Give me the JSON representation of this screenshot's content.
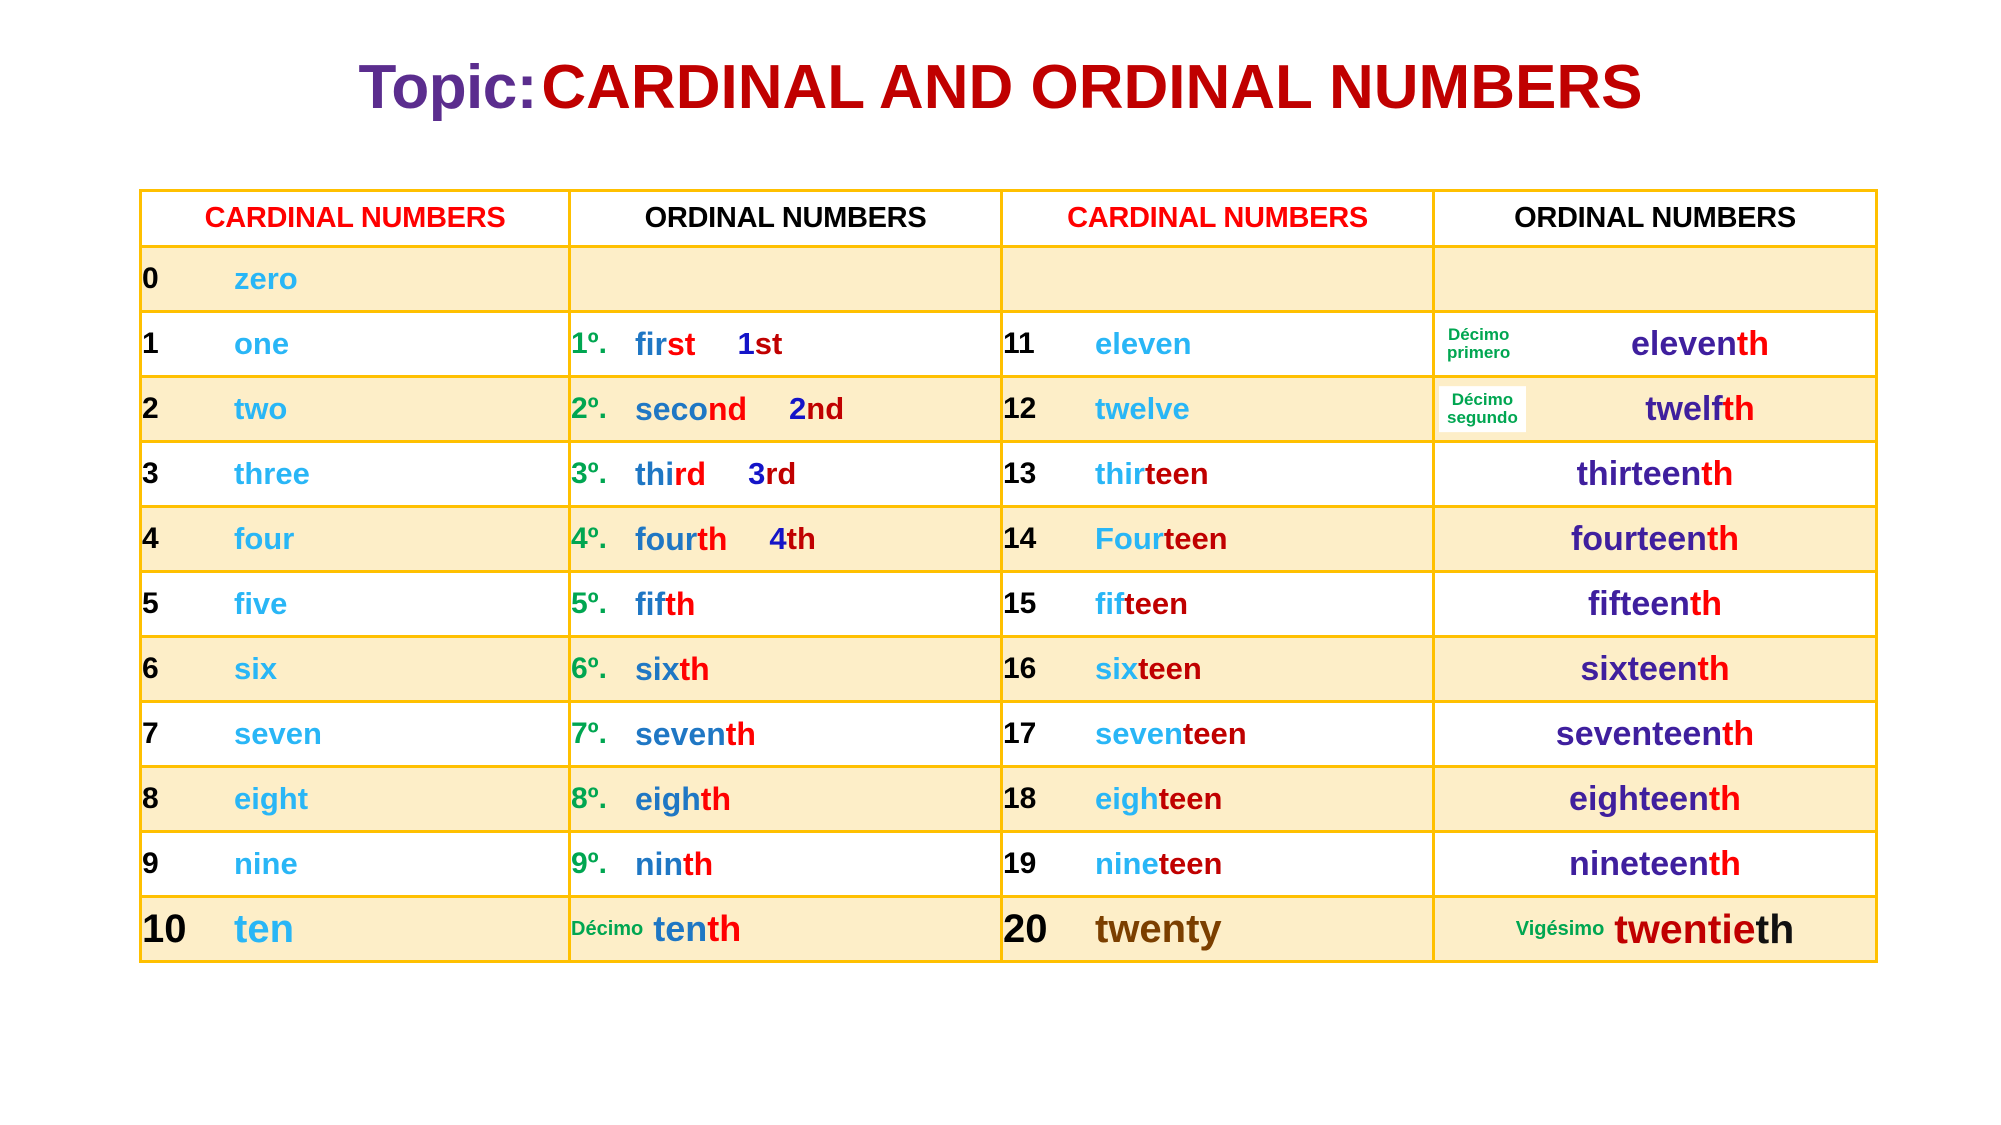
{
  "title": {
    "topic_label": "Topic:",
    "subject": "CARDINAL AND ORDINAL NUMBERS",
    "topic_color": "#5b2d8e",
    "subject_color": "#c00000"
  },
  "colors": {
    "border": "#ffc000",
    "row_shade": "#fdeec8",
    "row_plain": "#ffffff",
    "cardinal_header": "#ff0000",
    "ordinal_header": "#000000",
    "cardinal_word": "#29b6f6",
    "cardinal_suffix": "#c00000",
    "ordinal_marker_green": "#00a651",
    "ordinal_stem_blue": "#1f77c4",
    "ordinal_suffix_red": "#ff0000",
    "ordinal_stem_purple": "#3f1f9e",
    "twenty_brown": "#7b3f00"
  },
  "headers": {
    "left_cardinal": "CARDINAL NUMBERS",
    "left_ordinal": "ORDINAL NUMBERS",
    "right_cardinal": "CARDINAL NUMBERS",
    "right_ordinal": "ORDINAL NUMBERS"
  },
  "rows": [
    {
      "left": {
        "num": "0",
        "word_a": "zero",
        "word_b": ""
      },
      "left_ord": {
        "marker": "",
        "stem": "",
        "suffix": "",
        "abbr_num": "",
        "abbr_suffix": ""
      },
      "right": {
        "num": "",
        "word_a": "",
        "word_b": ""
      },
      "right_ord": {
        "hint": "",
        "stem": "",
        "suffix": ""
      }
    },
    {
      "left": {
        "num": "1",
        "word_a": "one",
        "word_b": ""
      },
      "left_ord": {
        "marker": "1º.",
        "stem": "fir",
        "suffix": "st",
        "abbr_num": "1",
        "abbr_suffix": "st"
      },
      "right": {
        "num": "11",
        "word_a": "eleven",
        "word_b": ""
      },
      "right_ord": {
        "hint": "Décimo primero",
        "stem": "eleven",
        "suffix": "th"
      }
    },
    {
      "left": {
        "num": "2",
        "word_a": "two",
        "word_b": ""
      },
      "left_ord": {
        "marker": "2º.",
        "stem": "seco",
        "suffix": "nd",
        "abbr_num": "2",
        "abbr_suffix": "nd"
      },
      "right": {
        "num": "12",
        "word_a": "twelve",
        "word_b": ""
      },
      "right_ord": {
        "hint": "Décimo segundo",
        "stem": "twelf",
        "suffix": "th"
      }
    },
    {
      "left": {
        "num": "3",
        "word_a": "three",
        "word_b": ""
      },
      "left_ord": {
        "marker": "3º.",
        "stem": "thi",
        "suffix": "rd",
        "abbr_num": "3",
        "abbr_suffix": "rd"
      },
      "right": {
        "num": "13",
        "word_a": "thir",
        "word_b": "teen"
      },
      "right_ord": {
        "hint": "",
        "stem": "thirteen",
        "suffix": "th"
      }
    },
    {
      "left": {
        "num": "4",
        "word_a": "four",
        "word_b": ""
      },
      "left_ord": {
        "marker": "4º.",
        "stem": "four",
        "suffix": "th",
        "abbr_num": "4",
        "abbr_suffix": "th"
      },
      "right": {
        "num": "14",
        "word_a": "Four",
        "word_b": "teen"
      },
      "right_ord": {
        "hint": "",
        "stem": "fourteen",
        "suffix": "th"
      }
    },
    {
      "left": {
        "num": "5",
        "word_a": "five",
        "word_b": ""
      },
      "left_ord": {
        "marker": "5º.",
        "stem": "fif",
        "suffix": "th",
        "abbr_num": "",
        "abbr_suffix": ""
      },
      "right": {
        "num": "15",
        "word_a": "fif",
        "word_b": "teen"
      },
      "right_ord": {
        "hint": "",
        "stem": "fifteen",
        "suffix": "th"
      }
    },
    {
      "left": {
        "num": "6",
        "word_a": "six",
        "word_b": ""
      },
      "left_ord": {
        "marker": "6º.",
        "stem": "six",
        "suffix": "th",
        "abbr_num": "",
        "abbr_suffix": ""
      },
      "right": {
        "num": "16",
        "word_a": "six",
        "word_b": "teen"
      },
      "right_ord": {
        "hint": "",
        "stem": "sixteen",
        "suffix": "th"
      }
    },
    {
      "left": {
        "num": "7",
        "word_a": "seven",
        "word_b": ""
      },
      "left_ord": {
        "marker": "7º.",
        "stem": "seven",
        "suffix": "th",
        "abbr_num": "",
        "abbr_suffix": ""
      },
      "right": {
        "num": "17",
        "word_a": "seven",
        "word_b": "teen"
      },
      "right_ord": {
        "hint": "",
        "stem": "seventeen",
        "suffix": "th"
      }
    },
    {
      "left": {
        "num": "8",
        "word_a": "eight",
        "word_b": ""
      },
      "left_ord": {
        "marker": "8º.",
        "stem": "eigh",
        "suffix": "th",
        "abbr_num": "",
        "abbr_suffix": ""
      },
      "right": {
        "num": "18",
        "word_a": "eigh",
        "word_b": "teen"
      },
      "right_ord": {
        "hint": "",
        "stem": "eighteen",
        "suffix": "th"
      }
    },
    {
      "left": {
        "num": "9",
        "word_a": "nine",
        "word_b": ""
      },
      "left_ord": {
        "marker": "9º.",
        "stem": "nin",
        "suffix": "th",
        "abbr_num": "",
        "abbr_suffix": ""
      },
      "right": {
        "num": "19",
        "word_a": "nine",
        "word_b": "teen"
      },
      "right_ord": {
        "hint": "",
        "stem": "nineteen",
        "suffix": "th"
      }
    },
    {
      "left": {
        "num": "10",
        "word_a": "ten",
        "word_b": ""
      },
      "left_ord": {
        "marker": "Décimo",
        "stem": "ten",
        "suffix": "th",
        "abbr_num": "",
        "abbr_suffix": ""
      },
      "right": {
        "num": "20",
        "word_a": "twenty",
        "word_b": ""
      },
      "right_ord": {
        "hint": "Vigésimo",
        "stem": "twentie",
        "suffix": "th"
      }
    }
  ]
}
